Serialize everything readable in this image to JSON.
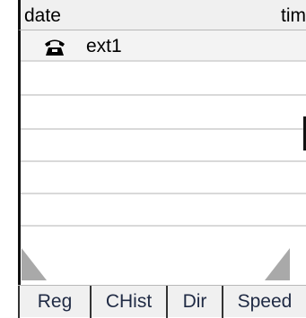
{
  "header": {
    "date_label": "date",
    "time_label": "time"
  },
  "rows": [
    {
      "icon": "telephone-icon",
      "label": "ext1"
    }
  ],
  "tabs": [
    {
      "label": "Reg"
    },
    {
      "label": "CHist"
    },
    {
      "label": "Dir"
    },
    {
      "label": "Speed"
    }
  ]
}
